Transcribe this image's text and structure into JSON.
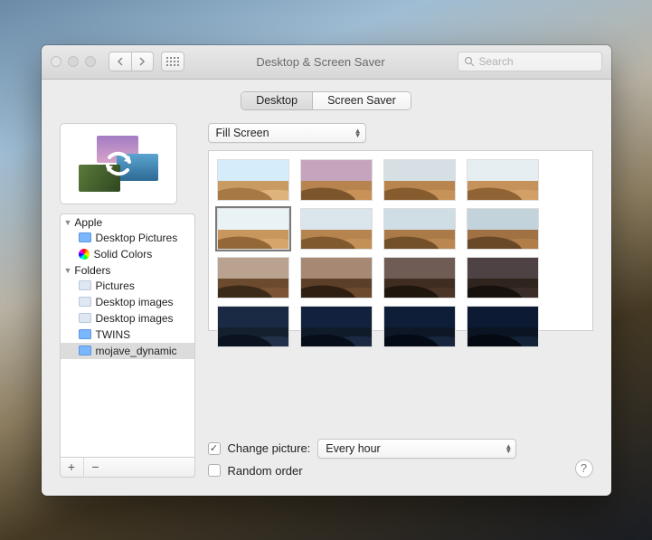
{
  "window": {
    "title": "Desktop & Screen Saver"
  },
  "toolbar": {
    "search_placeholder": "Search"
  },
  "tabs": {
    "desktop": "Desktop",
    "screensaver": "Screen Saver",
    "active": "desktop"
  },
  "fit_mode": {
    "selected": "Fill Screen"
  },
  "sidebar": {
    "groups": [
      {
        "label": "Apple",
        "expanded": true,
        "items": [
          {
            "label": "Desktop Pictures",
            "icon": "folder-blue",
            "selected": false
          },
          {
            "label": "Solid Colors",
            "icon": "color-wheel",
            "selected": false
          }
        ]
      },
      {
        "label": "Folders",
        "expanded": true,
        "items": [
          {
            "label": "Pictures",
            "icon": "folder",
            "selected": false
          },
          {
            "label": "Desktop images",
            "icon": "folder",
            "selected": false
          },
          {
            "label": "Desktop images",
            "icon": "folder",
            "selected": false
          },
          {
            "label": "TWINS",
            "icon": "folder-blue",
            "selected": false
          },
          {
            "label": "mojave_dynamic",
            "icon": "folder-blue",
            "selected": true
          }
        ]
      }
    ],
    "add_label": "+",
    "remove_label": "−"
  },
  "thumbnails": [
    {
      "sky": "#d5ecfa",
      "lit": "#dfb37c",
      "dark": "#a67843",
      "base": "#c99b63",
      "selected": false
    },
    {
      "sky": "#c7a4bd",
      "lit": "#c89158",
      "dark": "#7c552c",
      "base": "#b7834e",
      "selected": false
    },
    {
      "sky": "#d6dfe3",
      "lit": "#c79257",
      "dark": "#865c2f",
      "base": "#b9854f",
      "selected": false
    },
    {
      "sky": "#e6eef2",
      "lit": "#d2a066",
      "dark": "#8f6334",
      "base": "#c4925a",
      "selected": false
    },
    {
      "sky": "#e9f2f5",
      "lit": "#d6a56b",
      "dark": "#946736",
      "base": "#c8975e",
      "selected": true
    },
    {
      "sky": "#dbe6ec",
      "lit": "#c49058",
      "dark": "#80592f",
      "base": "#b6844f",
      "selected": false
    },
    {
      "sky": "#cfdde4",
      "lit": "#bb8750",
      "dark": "#73502a",
      "base": "#aa7a48",
      "selected": false
    },
    {
      "sky": "#c3d3db",
      "lit": "#b17e49",
      "dark": "#684826",
      "base": "#9f7143",
      "selected": false
    },
    {
      "sky": "#b9a28f",
      "lit": "#7a5433",
      "dark": "#3c2a18",
      "base": "#6b4a2e",
      "selected": false
    },
    {
      "sky": "#a68873",
      "lit": "#6b4a2e",
      "dark": "#2e1f12",
      "base": "#5c3f28",
      "selected": false
    },
    {
      "sky": "#6f5d55",
      "lit": "#4a3527",
      "dark": "#1f160e",
      "base": "#3e2d20",
      "selected": false
    },
    {
      "sky": "#4e4244",
      "lit": "#3a2d28",
      "dark": "#17110d",
      "base": "#2f241e",
      "selected": false
    },
    {
      "sky": "#1b2a44",
      "lit": "#223149",
      "dark": "#0b1220",
      "base": "#15202f",
      "selected": false
    },
    {
      "sky": "#12223e",
      "lit": "#1b2a42",
      "dark": "#070e1a",
      "base": "#101b2a",
      "selected": false
    },
    {
      "sky": "#0f1e38",
      "lit": "#17263d",
      "dark": "#050b16",
      "base": "#0d1726",
      "selected": false
    },
    {
      "sky": "#0c1a33",
      "lit": "#142238",
      "dark": "#040912",
      "base": "#0b1422",
      "selected": false
    }
  ],
  "options": {
    "change_picture": {
      "checked": true,
      "label": "Change picture:"
    },
    "interval": {
      "selected": "Every hour"
    },
    "random_order": {
      "checked": false,
      "label": "Random order"
    }
  },
  "help_label": "?"
}
